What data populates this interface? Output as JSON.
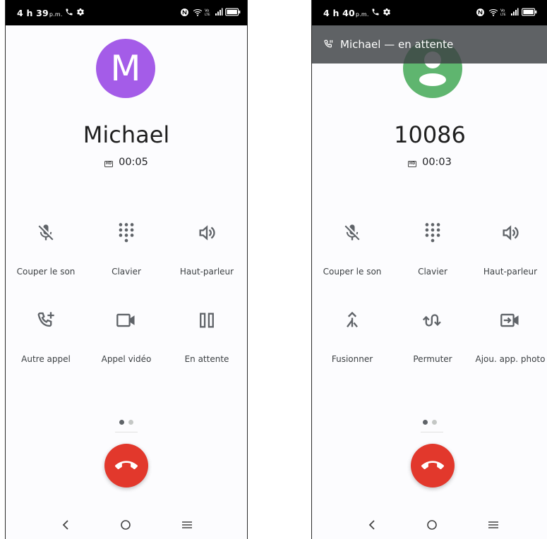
{
  "screens": [
    {
      "status": {
        "time": "4 h 39",
        "ampm": "p.m."
      },
      "avatar_letter": "M",
      "caller": "Michael",
      "timer": "00:05",
      "hd": "HD",
      "controls": [
        {
          "label": "Couper le son",
          "icon": "mic-off-icon"
        },
        {
          "label": "Clavier",
          "icon": "dialpad-icon"
        },
        {
          "label": "Haut-parleur",
          "icon": "speaker-icon"
        },
        {
          "label": "Autre appel",
          "icon": "add-call-icon"
        },
        {
          "label": "Appel vidéo",
          "icon": "videocam-icon"
        },
        {
          "label": "En attente",
          "icon": "pause-icon"
        }
      ]
    },
    {
      "status": {
        "time": "4 h 40",
        "ampm": "p.m."
      },
      "hold_banner": "Michael — en attente",
      "caller": "10086",
      "timer": "00:03",
      "hd": "HD",
      "controls": [
        {
          "label": "Couper le son",
          "icon": "mic-off-icon"
        },
        {
          "label": "Clavier",
          "icon": "dialpad-icon"
        },
        {
          "label": "Haut-parleur",
          "icon": "speaker-icon"
        },
        {
          "label": "Fusionner",
          "icon": "merge-icon"
        },
        {
          "label": "Permuter",
          "icon": "swap-calls-icon"
        },
        {
          "label": "Ajou. app. photo",
          "icon": "add-video-icon"
        }
      ]
    }
  ],
  "colors": {
    "avatar_m": "#a45ce8",
    "avatar_person": "#5fb56f",
    "end_call": "#e2382c"
  }
}
